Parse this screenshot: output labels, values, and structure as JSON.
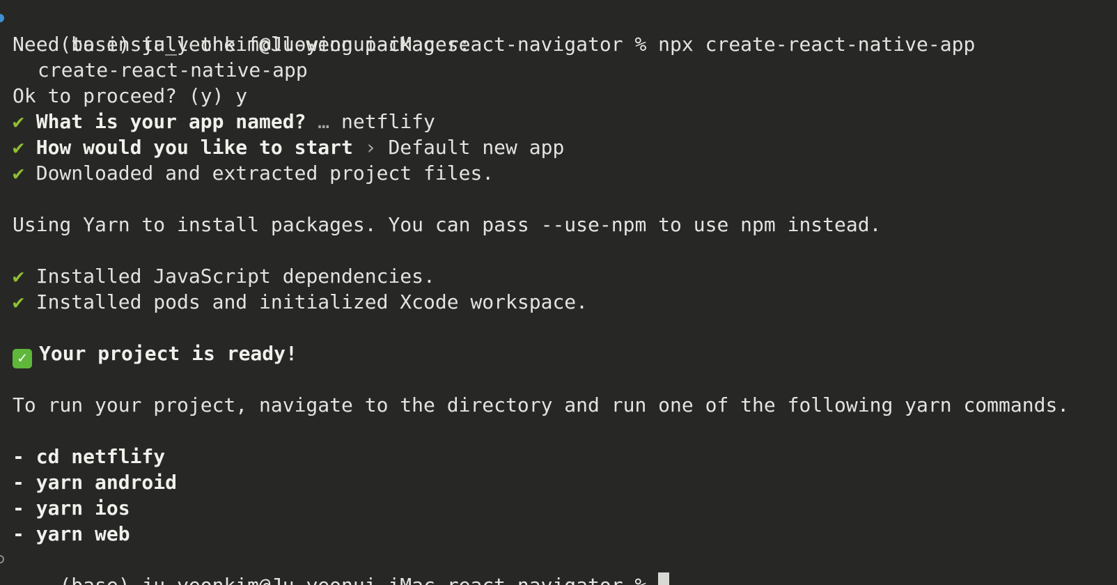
{
  "terminal": {
    "prompt": "(base) ju_yeonkim@Ju-yeonui-iMac react-navigator % ",
    "command": "npx create-react-native-app",
    "need_install": "Need to install the following packages:",
    "package_name": "create-react-native-app",
    "ok_proceed": "Ok to proceed? (y) y",
    "check_glyph": "✔",
    "q1_label": "What is your app named?",
    "q1_sep": " … ",
    "q1_answer": "netflify",
    "q2_label": "How would you like to start",
    "q2_sep": " › ",
    "q2_answer": "Default new app",
    "downloaded": "Downloaded and extracted project files.",
    "using_yarn": "Using Yarn to install packages. You can pass --use-npm to use npm instead.",
    "installed_js": "Installed JavaScript dependencies.",
    "installed_pods": "Installed pods and initialized Xcode workspace.",
    "ready_emoji": "✓",
    "ready_text": "Your project is ready!",
    "to_run": "To run your project, navigate to the directory and run one of the following yarn commands.",
    "commands": [
      "- cd netflify",
      "- yarn android",
      "- yarn ios",
      "- yarn web"
    ],
    "final_prompt": "(base) ju_yeonkim@Ju-yeonui-iMac react-navigator % "
  },
  "colors": {
    "background": "#272825",
    "text": "#e3e3e0",
    "check": "#8fbf33",
    "ready_badge": "#5fb83a",
    "prompt_marker_active": "#3f8fd6"
  }
}
